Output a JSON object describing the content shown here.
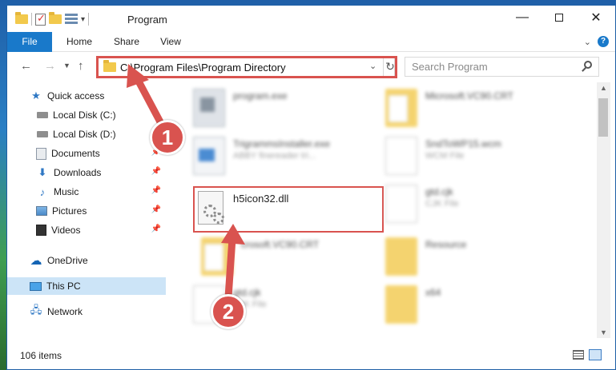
{
  "window": {
    "title": "Program",
    "controls": {
      "minimize": "—",
      "close": "✕"
    }
  },
  "ribbon": {
    "tabs": [
      "File",
      "Home",
      "Share",
      "View"
    ],
    "expand_glyph": "⌄",
    "help_glyph": "?"
  },
  "navbar": {
    "back_glyph": "←",
    "forward_glyph": "→",
    "dropdown_glyph": "▼",
    "up_glyph": "↑",
    "address": "C:\\Program Files\\Program Directory",
    "address_chevron": "⌄",
    "refresh_glyph": "↻",
    "search_placeholder": "Search Program"
  },
  "sidebar": {
    "items": [
      {
        "label": "Quick access",
        "icon": "star-icon",
        "pinned": false
      },
      {
        "label": "Local Disk (C:)",
        "icon": "disk-icon",
        "pinned": true
      },
      {
        "label": "Local Disk (D:)",
        "icon": "disk-icon",
        "pinned": true
      },
      {
        "label": "Documents",
        "icon": "documents-icon",
        "pinned": true
      },
      {
        "label": "Downloads",
        "icon": "download-icon",
        "pinned": true
      },
      {
        "label": "Music",
        "icon": "music-icon",
        "pinned": true
      },
      {
        "label": "Pictures",
        "icon": "pictures-icon",
        "pinned": true
      },
      {
        "label": "Videos",
        "icon": "videos-icon",
        "pinned": true
      },
      {
        "label": "OneDrive",
        "icon": "cloud-icon",
        "pinned": false
      },
      {
        "label": "This PC",
        "icon": "pc-icon",
        "pinned": false,
        "selected": true
      },
      {
        "label": "Network",
        "icon": "network-icon",
        "pinned": false
      }
    ],
    "pin_glyph": "📌"
  },
  "files": [
    {
      "name": "program.exe",
      "desc": "",
      "kind": "exe"
    },
    {
      "name": "Microsoft.VC90.CRT",
      "desc": "",
      "kind": "folder"
    },
    {
      "name": "TrigrammsInstaller.exe",
      "desc": "ABBY finereader tri...",
      "kind": "setup"
    },
    {
      "name": "SndToWP15.wcm",
      "desc": "WCM File",
      "kind": "doc"
    },
    {
      "name": "h5icon32.dll",
      "desc": "",
      "kind": "dll",
      "highlighted": true
    },
    {
      "name": "gtd.cjk",
      "desc": "CJK File",
      "kind": "doc"
    },
    {
      "name": "crosoft.VC90.CRT",
      "desc": "",
      "kind": "folder"
    },
    {
      "name": "Resource",
      "desc": "",
      "kind": "folder"
    },
    {
      "name": "gtd.cjk",
      "desc": "CJK File",
      "kind": "doc"
    },
    {
      "name": "x64",
      "desc": "",
      "kind": "folder"
    }
  ],
  "status": {
    "count": "106 items"
  },
  "annotations": {
    "step1": "1",
    "step2": "2"
  },
  "colors": {
    "accent": "#1979ca",
    "highlight": "#d9534f",
    "selection": "#cce4f7"
  }
}
